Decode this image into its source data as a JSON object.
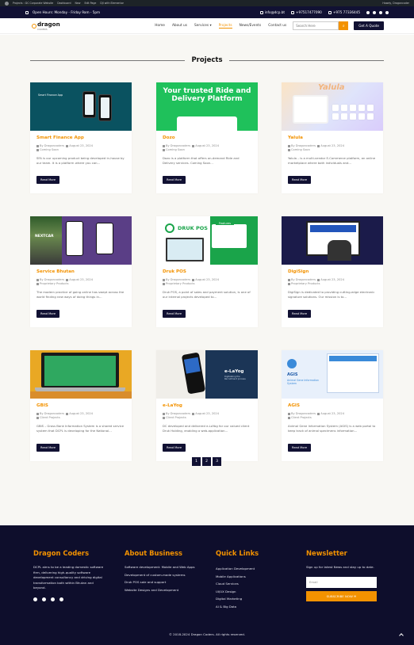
{
  "admin_bar": {
    "site": "Projects ‹ DC Corporate Website",
    "dashboard": "Dashboard",
    "new": "New",
    "edit": "Edit Page",
    "plugin": "DJI with Elementor",
    "howdy": "Howdy, Dragoncoder"
  },
  "topbar": {
    "hours": "Open Hours: Monday - Friday 9am - 5pm",
    "email": "info@dcp.bt",
    "phone1": "+97517477090",
    "phone2": "+975 77336445"
  },
  "header": {
    "logo": "dragon",
    "logo_sub": "CODERS",
    "nav": [
      "Home",
      "About us",
      "Services",
      "Projects",
      "News/Events",
      "Contact us"
    ],
    "services_caret": "▾",
    "search_placeholder": "Search Here",
    "quote_btn": "Get A Quote"
  },
  "page": {
    "title": "Projects"
  },
  "projects": [
    {
      "title": "Smart Finance App",
      "author": "Dragoncoders",
      "date": "August 23, 2024",
      "category": "Coming Soon",
      "desc": "SFA is our upcoming product being developed in-house by our team. It is a platform where you can...",
      "btn": "Read More",
      "thumb_text": "Smart Finance App"
    },
    {
      "title": "Dozo",
      "author": "Dragoncoders",
      "date": "August 23, 2024",
      "category": "Coming Soon",
      "desc": "Dozo is a platform that offers on-demand Ride and Delivery services. Coming Soon...",
      "btn": "Read More",
      "thumb_text": "Your trusted Ride and Delivery Platform"
    },
    {
      "title": "Yalula",
      "author": "Dragoncoders",
      "date": "August 23, 2024",
      "category": "Coming Soon",
      "desc": "Yalula – is a multi-vendor E-Commerce platform, an online marketplace where both individuals and...",
      "btn": "Read More",
      "thumb_text": "Yalula"
    },
    {
      "title": "Service Bhutan",
      "author": "Dragoncoders",
      "date": "August 23, 2024",
      "category": "Proprietary Products",
      "desc": "The modern practice of going online has swept across the world finding new ways of doing things in...",
      "btn": "Read More",
      "thumb_text": "NEXTCAR"
    },
    {
      "title": "Druk POS",
      "author": "Dragoncoders",
      "date": "August 23, 2024",
      "category": "Proprietary Products",
      "desc": "Druk POS, a point of sales and payment solution, is one of our internal projects developed to...",
      "btn": "Read More",
      "thumb_text": "DRUK POS",
      "thumb_badge": "Features"
    },
    {
      "title": "DigiSign",
      "author": "Dragoncoders",
      "date": "August 23, 2024",
      "category": "Proprietary Products",
      "desc": "DigiSign is dedicated to providing cutting-edge electronic signature solutions. Our mission is to...",
      "btn": "Read More"
    },
    {
      "title": "GBIS",
      "author": "Dragoncoders",
      "date": "August 23, 2024",
      "category": "Client Projects",
      "desc": "GBIS – Gross Bank Information System is a shared service system that DCPL is developing for the National...",
      "btn": "Read More"
    },
    {
      "title": "e-LaYog",
      "author": "Dragoncoders",
      "date": "August 23, 2024",
      "category": "Client Projects",
      "desc": "DC developed and delivered e-LaYog for our valued client Druk Holding, enabling a web-application...",
      "btn": "Read More",
      "thumb_text": "e-LaYog",
      "thumb_sub": "Digitalizing the Recruitment process"
    },
    {
      "title": "AGIS",
      "author": "Dragoncoders",
      "date": "August 23, 2024",
      "category": "Client Projects",
      "desc": "Animal Gene Information System (AGIS) is a web portal to keep track of animal specimens information...",
      "btn": "Read More",
      "thumb_text": "AGIS",
      "thumb_sub": "Animal Gene Information System"
    }
  ],
  "pagination": [
    "1",
    "2",
    "3"
  ],
  "footer": {
    "about_title": "Dragon Coders",
    "about_text": "DCPL aims to be a leading domestic software firm, delivering high-quality software development consultancy and driving digital transformation both within Bhutan and beyond.",
    "business_title": "About Business",
    "business_items": [
      "Software development: Mobile and Web Apps",
      "Development of custom-made systems",
      "Druk POS sale and support",
      "Website Designs and Development"
    ],
    "links_title": "Quick Links",
    "links": [
      "Application Development",
      "Mobile Applications",
      "Cloud Services",
      "UI/UX Design",
      "Digital Marketing",
      "AI & Big Data"
    ],
    "newsletter_title": "Newsletter",
    "newsletter_text": "Sign up for latest News and stay up to date.",
    "email_placeholder": "Email",
    "subscribe": "SUBSCRIBE NOW ✉",
    "copyright": "© 2018-2024 Dragon Coders. All rights reserved."
  },
  "colors": {
    "accent": "#f39200",
    "navy": "#111133",
    "footer_bg": "#0e0e2c",
    "page_bg": "#f8f7f3"
  }
}
